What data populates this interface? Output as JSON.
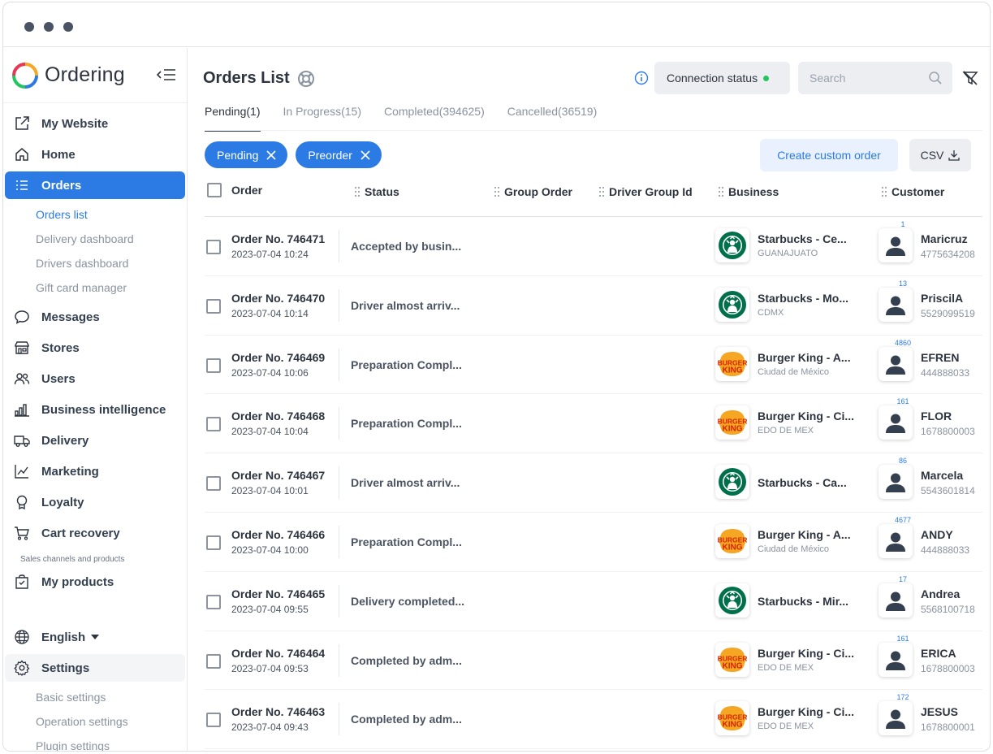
{
  "window": {
    "dots": 3
  },
  "brand": {
    "name": "Ordering"
  },
  "sidebar": {
    "items": [
      {
        "label": "My Website",
        "icon": "external-link-icon"
      },
      {
        "label": "Home",
        "icon": "home-icon"
      },
      {
        "label": "Orders",
        "icon": "list-icon",
        "active": true
      }
    ],
    "orders_sub": [
      "Orders list",
      "Delivery dashboard",
      "Drivers dashboard",
      "Gift card manager"
    ],
    "items2": [
      {
        "label": "Messages",
        "icon": "chat-icon"
      },
      {
        "label": "Stores",
        "icon": "store-icon"
      },
      {
        "label": "Users",
        "icon": "users-icon"
      },
      {
        "label": "Business intelligence",
        "icon": "bar-chart-icon"
      },
      {
        "label": "Delivery",
        "icon": "truck-icon"
      },
      {
        "label": "Marketing",
        "icon": "line-chart-icon"
      },
      {
        "label": "Loyalty",
        "icon": "award-icon"
      },
      {
        "label": "Cart recovery",
        "icon": "cart-icon"
      }
    ],
    "section_label": "Sales channels and products",
    "my_products": "My products",
    "language": "English",
    "settings": "Settings",
    "settings_sub": [
      "Basic settings",
      "Operation settings",
      "Plugin settings"
    ]
  },
  "header": {
    "title": "Orders List",
    "connection_status": "Connection status",
    "search_placeholder": "Search"
  },
  "tabs": [
    {
      "label": "Pending(1)",
      "active": true
    },
    {
      "label": "In Progress(15)"
    },
    {
      "label": "Completed(394625)"
    },
    {
      "label": "Cancelled(36519)"
    }
  ],
  "filters": [
    "Pending",
    "Preorder"
  ],
  "actions": {
    "create": "Create custom order",
    "csv": "CSV"
  },
  "columns": {
    "order": "Order",
    "status": "Status",
    "group_order": "Group Order",
    "driver_group": "Driver Group Id",
    "business": "Business",
    "customer": "Customer"
  },
  "colors": {
    "accent": "#2c7be5",
    "starbucks": "#00704a",
    "burger_king": "#d62300"
  },
  "rows": [
    {
      "order": "Order No. 746471",
      "date": "2023-07-04 10:24",
      "status": "Accepted by busin...",
      "biz": "starbucks",
      "biz_name": "Starbucks - Ce...",
      "city": "GUANAJUATO",
      "count": "1",
      "cust": "Maricruz",
      "phone": "4775634208"
    },
    {
      "order": "Order No. 746470",
      "date": "2023-07-04 10:14",
      "status": "Driver almost arriv...",
      "biz": "starbucks",
      "biz_name": "Starbucks - Mo...",
      "city": "CDMX",
      "count": "13",
      "cust": "PriscilA",
      "phone": "5529099519"
    },
    {
      "order": "Order No. 746469",
      "date": "2023-07-04 10:06",
      "status": "Preparation Compl...",
      "biz": "burger_king",
      "biz_name": "Burger King - A...",
      "city": "Ciudad de México",
      "count": "4860",
      "cust": "EFREN",
      "phone": "444888033"
    },
    {
      "order": "Order No. 746468",
      "date": "2023-07-04 10:04",
      "status": "Preparation Compl...",
      "biz": "burger_king",
      "biz_name": "Burger King - Ci...",
      "city": "EDO DE MEX",
      "count": "161",
      "cust": "FLOR",
      "phone": "1678800003"
    },
    {
      "order": "Order No. 746467",
      "date": "2023-07-04 10:01",
      "status": "Driver almost arriv...",
      "biz": "starbucks",
      "biz_name": "Starbucks - Ca...",
      "city": "",
      "count": "86",
      "cust": "Marcela",
      "phone": "5543601814"
    },
    {
      "order": "Order No. 746466",
      "date": "2023-07-04 10:00",
      "status": "Preparation Compl...",
      "biz": "burger_king",
      "biz_name": "Burger King - A...",
      "city": "Ciudad de México",
      "count": "4677",
      "cust": "ANDY",
      "phone": "444888033"
    },
    {
      "order": "Order No. 746465",
      "date": "2023-07-04 09:55",
      "status": "Delivery completed...",
      "biz": "starbucks",
      "biz_name": "Starbucks - Mir...",
      "city": "",
      "count": "17",
      "cust": "Andrea",
      "phone": "5568100718"
    },
    {
      "order": "Order No. 746464",
      "date": "2023-07-04 09:53",
      "status": "Completed by adm...",
      "biz": "burger_king",
      "biz_name": "Burger King - Ci...",
      "city": "EDO DE MEX",
      "count": "161",
      "cust": "ERICA",
      "phone": "1678800003"
    },
    {
      "order": "Order No. 746463",
      "date": "2023-07-04 09:43",
      "status": "Completed by adm...",
      "biz": "burger_king",
      "biz_name": "Burger King - Ci...",
      "city": "EDO DE MEX",
      "count": "172",
      "cust": "JESUS",
      "phone": "1678800001"
    }
  ]
}
